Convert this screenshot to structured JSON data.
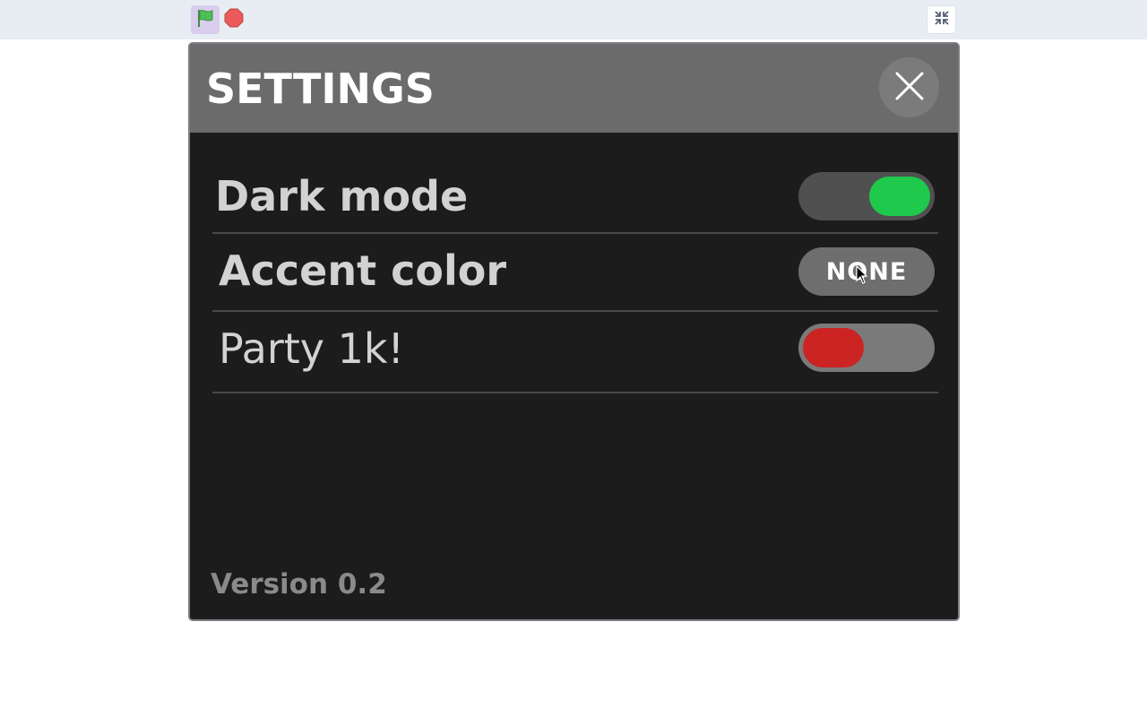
{
  "toolbar": {
    "green_flag_icon": "green-flag-icon",
    "stop_icon": "stop-icon",
    "shrink_icon": "shrink-stage-icon"
  },
  "settings": {
    "title": "SETTINGS",
    "rows": [
      {
        "label": "Dark mode",
        "control": "toggle",
        "state": "on",
        "color": "#1ec94c"
      },
      {
        "label": "Accent color",
        "control": "button",
        "value": "NONE"
      },
      {
        "label": "Party 1k!",
        "control": "toggle",
        "state": "off",
        "color": "#cc2323"
      }
    ],
    "version": "Version 0.2"
  },
  "colors": {
    "header": "#6b6b6b",
    "panel": "#1c1c1d",
    "toggle_on": "#1ec94c",
    "toggle_off": "#cc2323"
  }
}
